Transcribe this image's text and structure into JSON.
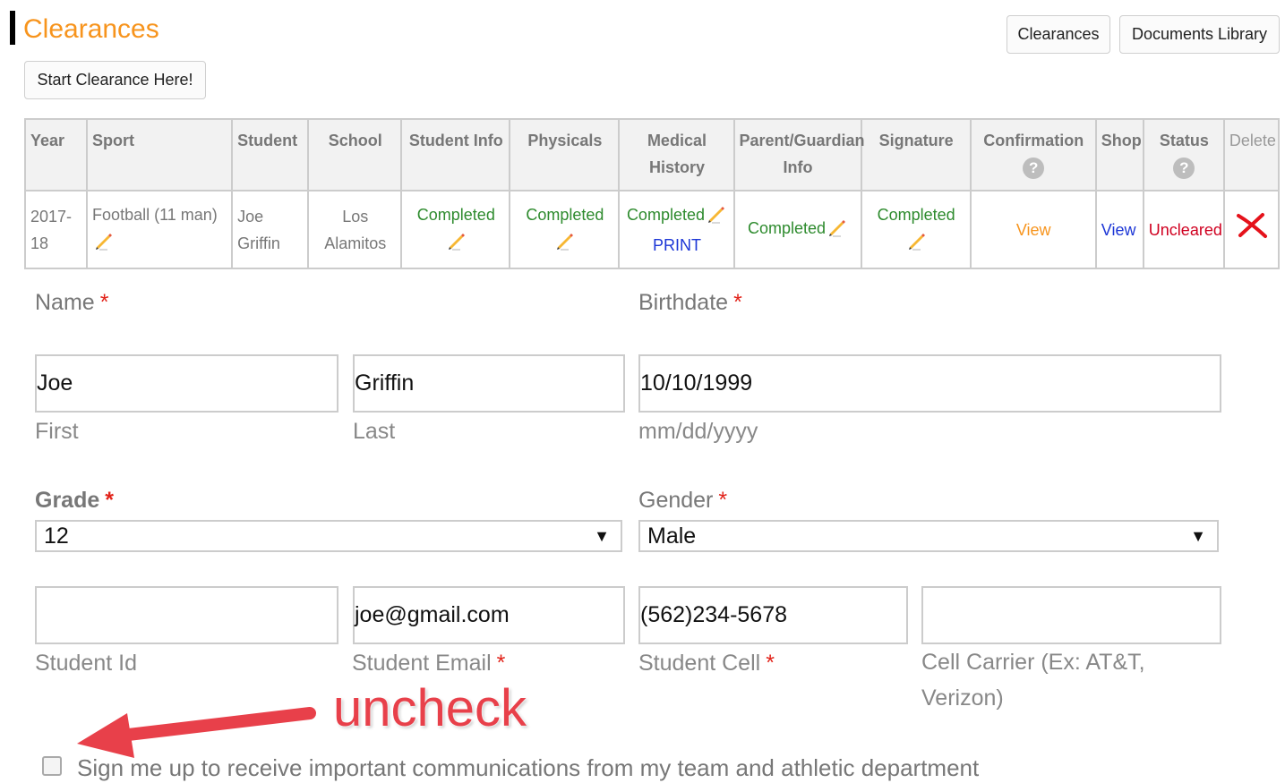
{
  "header": {
    "title": "Clearances",
    "buttons": {
      "clearances": "Clearances",
      "documents_library": "Documents Library",
      "start": "Start Clearance Here!"
    }
  },
  "table": {
    "headers": {
      "year": "Year",
      "sport": "Sport",
      "student": "Student",
      "school": "School",
      "student_info": "Student Info",
      "physicals": "Physicals",
      "medical_history_1": "Medical",
      "medical_history_2": "History",
      "parent_info_1": "Parent/Guardian",
      "parent_info_2": "Info",
      "signature": "Signature",
      "confirmation": "Confirmation",
      "shop": "Shop",
      "status": "Status",
      "delete": "Delete",
      "help_glyph": "?"
    },
    "row": {
      "year_1": "2017-",
      "year_2": "18",
      "sport": "Football (11 man)",
      "student_1": "Joe",
      "student_2": "Griffin",
      "school_1": "Los",
      "school_2": "Alamitos",
      "student_info": "Completed",
      "physicals": "Completed",
      "medical_history": "Completed",
      "medical_print": "PRINT",
      "parent_info": "Completed",
      "signature": "Completed",
      "confirmation": "View",
      "shop": "View",
      "status": "Uncleared"
    }
  },
  "form": {
    "name_label": "Name",
    "birthdate_label": "Birthdate",
    "required_mark": "*",
    "first_value": "Joe",
    "last_value": "Griffin",
    "birthdate_value": "10/10/1999",
    "first_sub": "First",
    "last_sub": "Last",
    "birthdate_sub": "mm/dd/yyyy",
    "grade_label": "Grade",
    "gender_label": "Gender",
    "grade_value": "12",
    "gender_value": "Male",
    "caret": "▼",
    "student_id_value": "",
    "email_value": "joe@gmail.com",
    "cell_value": "(562)234-5678",
    "carrier_value": "",
    "student_id_sub": "Student Id",
    "email_sub": "Student Email",
    "cell_sub": "Student Cell",
    "carrier_sub_1": "Cell Carrier (Ex: AT&T,",
    "carrier_sub_2": "Verizon)",
    "signup_label": "Sign me up to receive important communications from my team and athletic department"
  },
  "annotation": {
    "text": "uncheck",
    "color": "#e8404a"
  },
  "colors": {
    "accent": "#f7941d",
    "completed": "#2e8b2e",
    "link": "#1c36d6",
    "uncleared": "#d00020",
    "required": "#e2231a"
  }
}
